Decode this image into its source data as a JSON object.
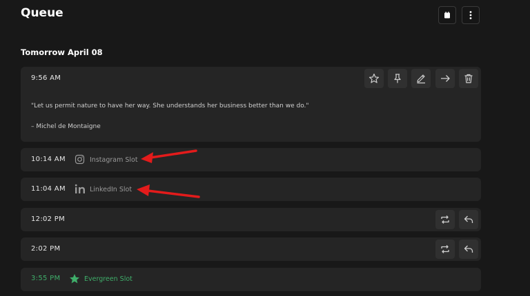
{
  "header": {
    "title": "Queue"
  },
  "queue": {
    "date_label": "Tomorrow April 08",
    "post": {
      "time": "9:56 AM",
      "quote": "\"Let us permit nature to have her way. She understands her business better than we do.\"",
      "author": "– Michel de Montaigne"
    },
    "slots": [
      {
        "time": "10:14 AM",
        "label": "Instagram Slot",
        "icon": "instagram-icon"
      },
      {
        "time": "11:04 AM",
        "label": "LinkedIn Slot",
        "icon": "linkedin-icon"
      },
      {
        "time": "12:02 PM",
        "label": "",
        "icon": ""
      },
      {
        "time": "2:02 PM",
        "label": "",
        "icon": ""
      },
      {
        "time": "3:55 PM",
        "label": "Evergreen Slot",
        "icon": "star-icon"
      }
    ]
  },
  "colors": {
    "background": "#181818",
    "card": "#252525",
    "button": "#303030",
    "evergreen": "#3fae6a",
    "annotation_arrow": "#e31b1b"
  }
}
